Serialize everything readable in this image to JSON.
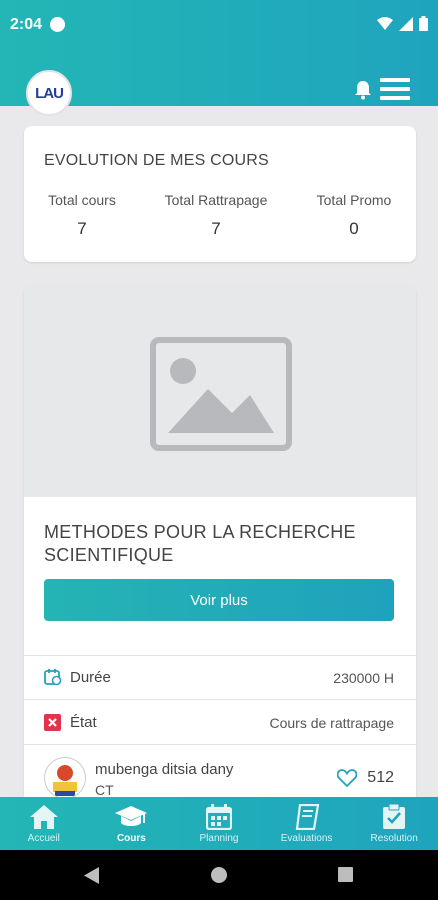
{
  "status_bar": {
    "time": "2:04"
  },
  "header": {
    "logo_text": "LAU"
  },
  "stats": {
    "title": "EVOLUTION DE MES COURS",
    "items": [
      {
        "label": "Total cours",
        "value": "7"
      },
      {
        "label": "Total Rattrapage",
        "value": "7"
      },
      {
        "label": "Total Promo",
        "value": "0"
      }
    ]
  },
  "course": {
    "title": "METHODES POUR LA RECHERCHE SCIENTIFIQUE",
    "button_label": "Voir plus",
    "duration_label": "Durée",
    "duration_value": "230000 H",
    "state_label": "État",
    "state_value": "Cours de rattrapage",
    "author_name": "mubenga ditsia dany",
    "author_role": "CT",
    "likes": "512"
  },
  "bottom_nav": {
    "items": [
      {
        "label": "Accueil",
        "icon": "home-icon"
      },
      {
        "label": "Cours",
        "icon": "graduation-cap-icon"
      },
      {
        "label": "Planning",
        "icon": "calendar-icon"
      },
      {
        "label": "Evaluations",
        "icon": "book-icon"
      },
      {
        "label": "Resolution",
        "icon": "clipboard-check-icon"
      }
    ],
    "active": "Cours"
  },
  "colors": {
    "primary": "#23b6b5",
    "secondary": "#1fa4be",
    "state_icon": "#e0344a"
  }
}
